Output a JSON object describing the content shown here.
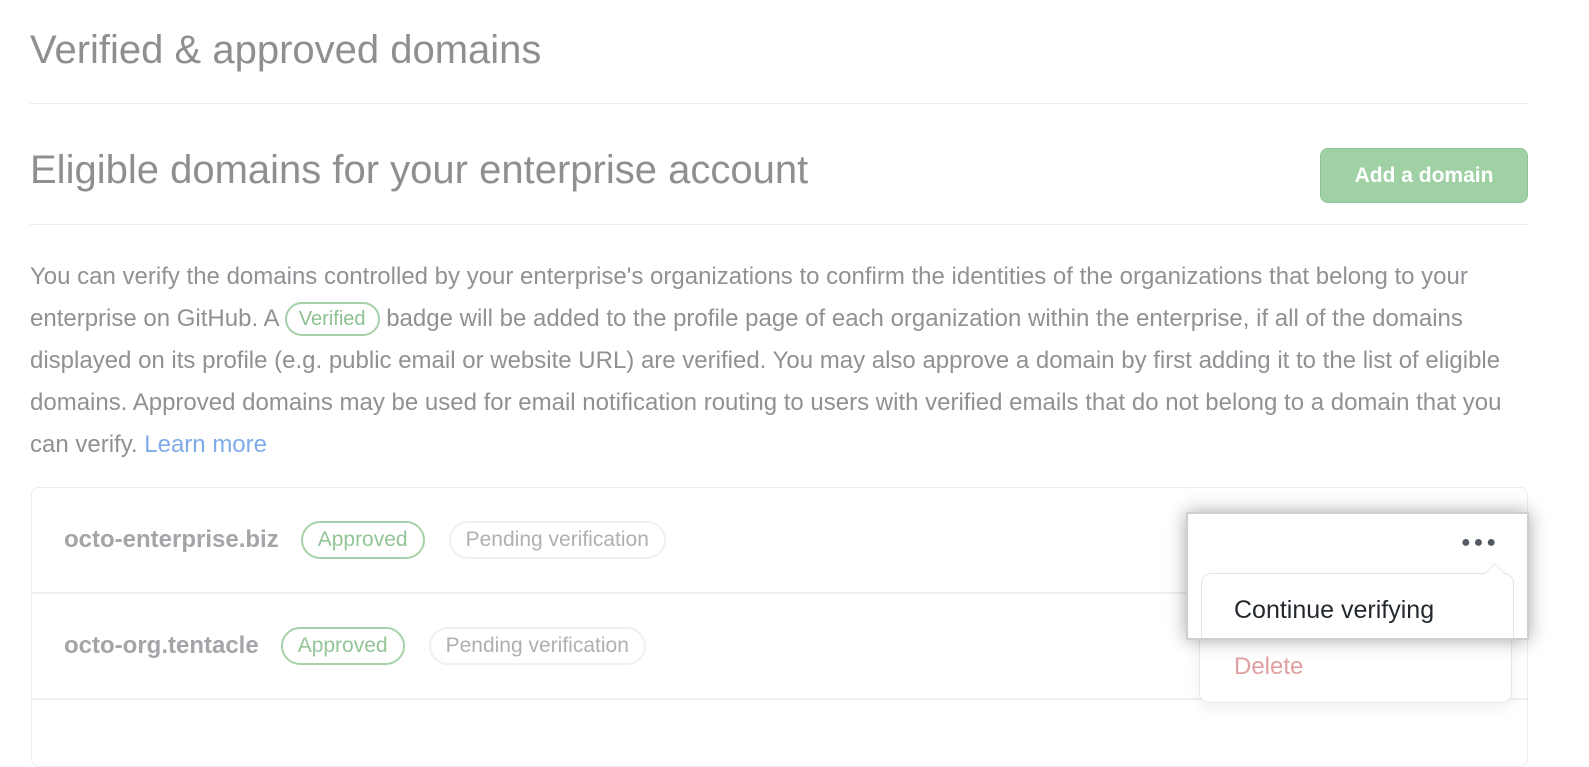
{
  "title": "Verified & approved domains",
  "section_title": "Eligible domains for your enterprise account",
  "add_button": "Add a domain",
  "description": {
    "part1": "You can verify the domains controlled by your enterprise's organizations to confirm the identities of the organizations that belong to your enterprise on GitHub. A ",
    "badge": "Verified",
    "part2": " badge will be added to the profile page of each organization within the enterprise, if all of the domains displayed on its profile (e.g. public email or website URL) are verified. You may also approve a domain by first adding it to the list of eligible domains. Approved domains may be used for email notification routing to users with verified emails that do not belong to a domain that you can verify. ",
    "link": "Learn more"
  },
  "domains": [
    {
      "name": "octo-enterprise.biz",
      "approved": "Approved",
      "status": "Pending verification"
    },
    {
      "name": "octo-org.tentacle",
      "approved": "Approved",
      "status": "Pending verification"
    }
  ],
  "menu": {
    "more_icon": "kebab-horizontal",
    "continue": "Continue verifying",
    "delete": "Delete"
  }
}
